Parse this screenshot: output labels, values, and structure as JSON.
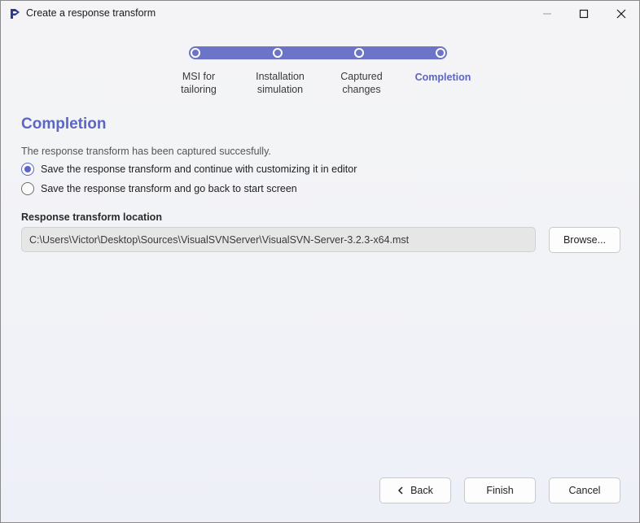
{
  "window": {
    "title": "Create a response transform",
    "icon": "app-logo-icon"
  },
  "stepper": {
    "steps": [
      {
        "label": "MSI for\ntailoring",
        "active": false
      },
      {
        "label": "Installation\nsimulation",
        "active": false
      },
      {
        "label": "Captured\nchanges",
        "active": false
      },
      {
        "label": "Completion",
        "active": true
      }
    ],
    "accent": "#6b74c8"
  },
  "main": {
    "title": "Completion",
    "subtitle": "The response transform has been captured succesfully.",
    "options": [
      {
        "label": "Save the response transform and continue with customizing it in editor",
        "checked": true
      },
      {
        "label": "Save the response transform and go back to start screen",
        "checked": false
      }
    ],
    "location_label": "Response transform location",
    "location_value": "C:\\Users\\Victor\\Desktop\\Sources\\VisualSVNServer\\VisualSVN-Server-3.2.3-x64.mst",
    "browse_label": "Browse..."
  },
  "footer": {
    "back_label": "Back",
    "finish_label": "Finish",
    "cancel_label": "Cancel"
  },
  "colors": {
    "accent": "#5c66c4",
    "input_bg": "#e6e6e6"
  }
}
